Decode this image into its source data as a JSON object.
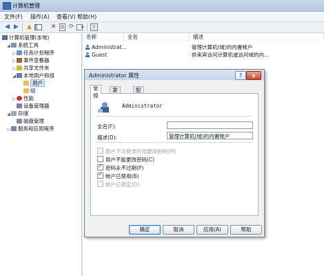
{
  "window": {
    "title": "计算机管理"
  },
  "menu": [
    "文件(F)",
    "操作(A)",
    "查看(V)",
    "帮助(H)"
  ],
  "toolbar": {
    "icons": [
      "back-arrow-icon",
      "forward-arrow-icon",
      "up-folder-icon",
      "show-hide-tree-icon",
      "delete-icon",
      "properties-icon",
      "refresh-icon",
      "export-list-icon",
      "help-icon"
    ]
  },
  "tree": {
    "items": [
      {
        "label": "计算机管理(本地)"
      },
      {
        "label": "系统工具"
      },
      {
        "label": "任务计划程序"
      },
      {
        "label": "事件查看器"
      },
      {
        "label": "共享文件夹"
      },
      {
        "label": "本地用户和组"
      },
      {
        "label": "用户"
      },
      {
        "label": "组"
      },
      {
        "label": "性能"
      },
      {
        "label": "设备管理器"
      },
      {
        "label": "存储"
      },
      {
        "label": "磁盘管理"
      },
      {
        "label": "服务和应用程序"
      }
    ]
  },
  "list": {
    "columns": [
      "名称",
      "全名",
      "描述"
    ],
    "rows": [
      {
        "name": "Administrat...",
        "fullname": "",
        "description": "管理计算机(域)的内置帐户"
      },
      {
        "name": "Guest",
        "fullname": "",
        "description": "供来宾访问计算机或访问域的内..."
      }
    ]
  },
  "dialog": {
    "title": "Administrator 属性",
    "help_label": "?",
    "close_label": "x",
    "tabs": [
      "常规",
      "隶属于",
      "配置文件"
    ],
    "username": "Administrator",
    "fullname_label": "全名(F):",
    "fullname_value": "",
    "description_label": "描述(D):",
    "description_value": "管理计算机(域)的内置帐户",
    "checkboxes": [
      {
        "label": "用户下次登录时须更改密码(M)",
        "checked": false,
        "disabled": true
      },
      {
        "label": "用户不能更改密码(C)",
        "checked": false,
        "disabled": false
      },
      {
        "label": "密码永不过期(P)",
        "checked": true,
        "disabled": false
      },
      {
        "label": "帐户已禁用(B)",
        "checked": true,
        "disabled": false
      },
      {
        "label": "帐户已锁定(O)",
        "checked": false,
        "disabled": true
      }
    ],
    "buttons": {
      "ok": "确定",
      "cancel": "取消",
      "apply": "应用(A)",
      "help": "帮助"
    }
  }
}
